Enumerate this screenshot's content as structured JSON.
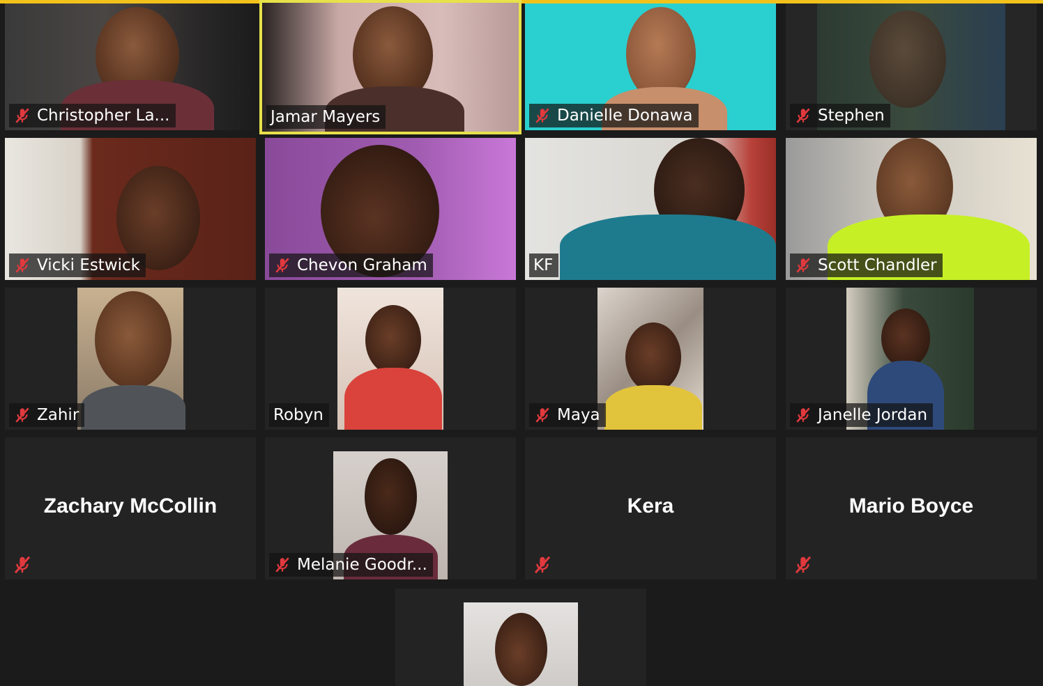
{
  "meeting": {
    "accent_color": "#f2c21b",
    "active_speaker_color": "#e7e14a",
    "muted_icon": "muted-microphone-icon",
    "participants": [
      {
        "name": "Christopher La...",
        "muted": true
      },
      {
        "name": "Jamar Mayers",
        "muted": false,
        "active_speaker": true
      },
      {
        "name": "Danielle Donawa",
        "muted": true
      },
      {
        "name": "Stephen",
        "muted": true
      },
      {
        "name": "Vicki Estwick",
        "muted": true
      },
      {
        "name": "Chevon Graham",
        "muted": true
      },
      {
        "name": "KF",
        "muted": false
      },
      {
        "name": "Scott Chandler",
        "muted": true
      },
      {
        "name": "Zahir",
        "muted": true
      },
      {
        "name": "Robyn",
        "muted": false
      },
      {
        "name": "Maya",
        "muted": true
      },
      {
        "name": "Janelle Jordan",
        "muted": true
      },
      {
        "name": "Zachary McCollin",
        "muted": true,
        "video_off": true
      },
      {
        "name": "Melanie Goodr...",
        "muted": true
      },
      {
        "name": "Kera",
        "muted": true,
        "video_off": true
      },
      {
        "name": "Mario Boyce",
        "muted": true,
        "video_off": true
      },
      {
        "name": "",
        "muted": false
      }
    ]
  }
}
